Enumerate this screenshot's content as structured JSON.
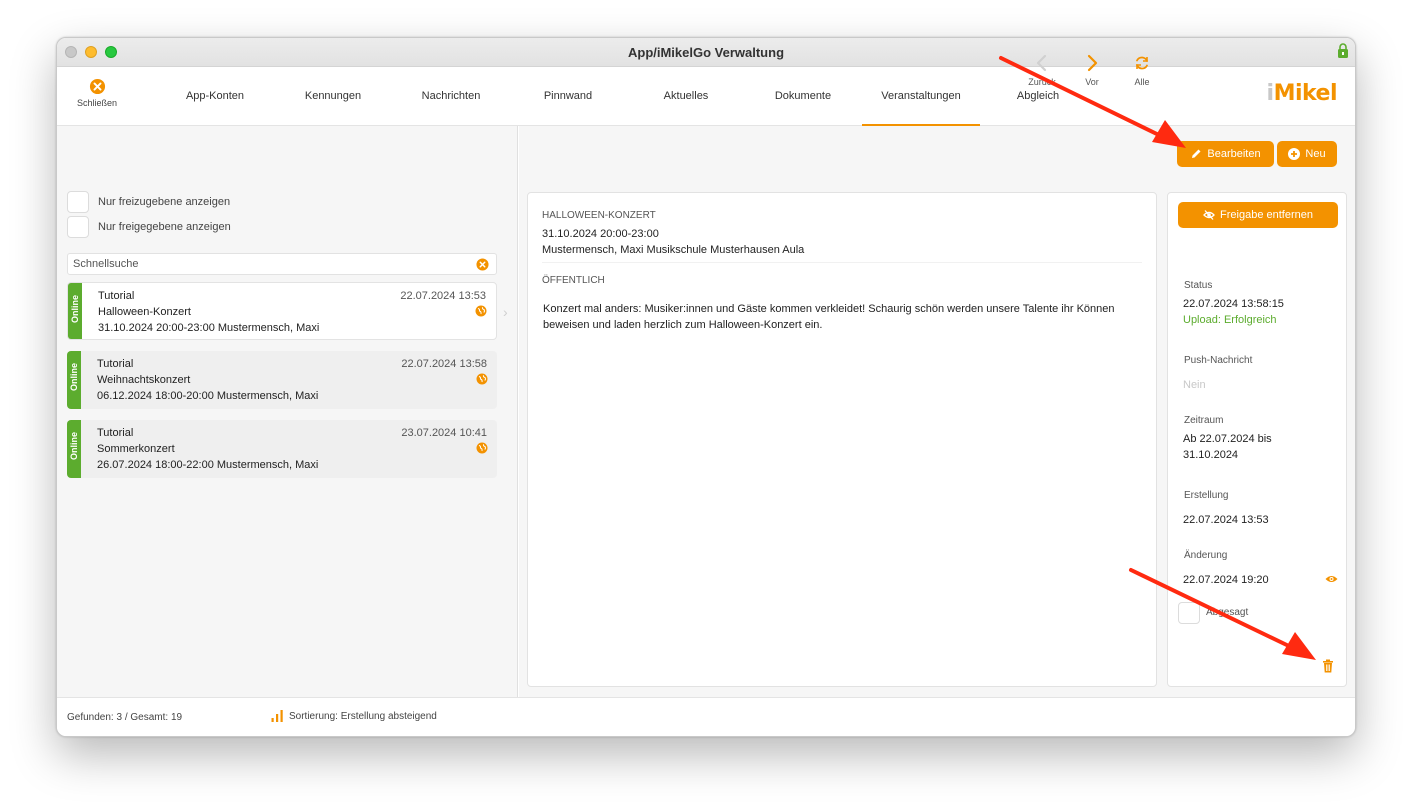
{
  "window": {
    "title": "App/iMikelGo Verwaltung"
  },
  "toolbar": {
    "close_label": "Schließen",
    "tabs": [
      {
        "label": "App-Konten"
      },
      {
        "label": "Kennungen"
      },
      {
        "label": "Nachrichten"
      },
      {
        "label": "Pinnwand"
      },
      {
        "label": "Aktuelles"
      },
      {
        "label": "Dokumente"
      },
      {
        "label": "Veranstaltungen",
        "active": true
      },
      {
        "label": "Abgleich"
      }
    ],
    "logo_i": "i",
    "logo_rest": "Mikel"
  },
  "filters": {
    "only_unreleased": "Nur freizugebene anzeigen",
    "only_released": "Nur freigegebene anzeigen",
    "search_placeholder": "Schnellsuche"
  },
  "events": [
    {
      "status": "Online",
      "category": "Tutorial",
      "title": "Halloween-Konzert",
      "info": "31.10.2024 20:00-23:00 Mustermensch, Maxi",
      "date": "22.07.2024 13:53",
      "selected": true
    },
    {
      "status": "Online",
      "category": "Tutorial",
      "title": "Weihnachtskonzert",
      "info": "06.12.2024 18:00-20:00 Mustermensch, Maxi",
      "date": "22.07.2024 13:58"
    },
    {
      "status": "Online",
      "category": "Tutorial",
      "title": "Sommerkonzert",
      "info": "26.07.2024 18:00-22:00 Mustermensch, Maxi",
      "date": "23.07.2024 10:41"
    }
  ],
  "nav": {
    "back": "Zurück",
    "next": "Vor",
    "all": "Alle"
  },
  "actions": {
    "edit": "Bearbeiten",
    "new": "Neu",
    "unrelease": "Freigabe entfernen"
  },
  "detail": {
    "heading": "HALLOWEEN-KONZERT",
    "datetime": "31.10.2024 20:00-23:00",
    "location": "Mustermensch, Maxi Musikschule Musterhausen Aula",
    "visibility": "ÖFFENTLICH",
    "description": "Konzert mal anders: Musiker:innen und Gäste kommen verkleidet! Schaurig schön werden unsere Talente ihr Können beweisen und laden herzlich zum Halloween-Konzert ein."
  },
  "side": {
    "status_label": "Status",
    "status_time": "22.07.2024 13:58:15",
    "status_upload": "Upload: Erfolgreich",
    "push_label": "Push-Nachricht",
    "push_value": "Nein",
    "period_label": "Zeitraum",
    "period_value": "Ab 22.07.2024 bis 31.10.2024",
    "created_label": "Erstellung",
    "created_value": "22.07.2024 13:53",
    "changed_label": "Änderung",
    "changed_value": "22.07.2024 19:20",
    "cancelled_label": "Abgesagt"
  },
  "statusbar": {
    "found": "Gefunden: 3 / Gesamt: 19",
    "sort": "Sortierung: Erstellung absteigend"
  },
  "colors": {
    "accent": "#f39200",
    "online": "#5cac2e",
    "annotation": "#ff2a10"
  }
}
